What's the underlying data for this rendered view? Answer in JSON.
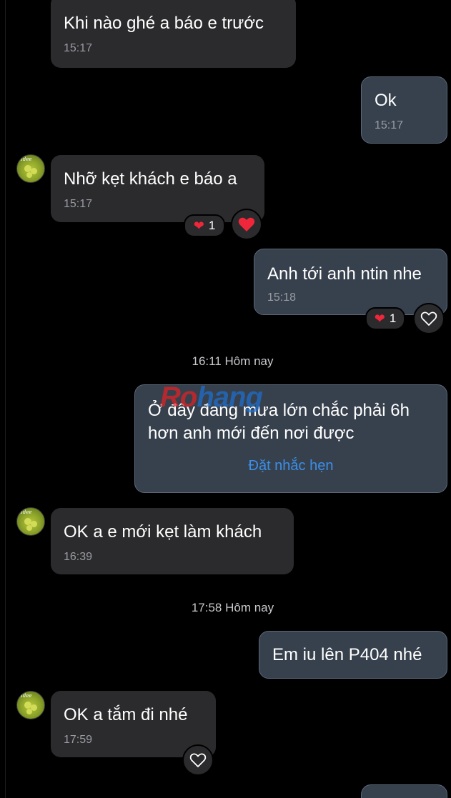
{
  "colors": {
    "background": "#000000",
    "incoming_bubble": "#2b2b2d",
    "outgoing_bubble": "#37414d",
    "outgoing_border": "#5b6878",
    "heart": "#f0263a",
    "link": "#3b8fe8"
  },
  "messages": [
    {
      "direction": "incoming",
      "text": "Khi nào ghé a báo e trước",
      "time": "15:17"
    },
    {
      "direction": "outgoing",
      "text": "Ok",
      "time": "15:17"
    },
    {
      "direction": "incoming",
      "text": "Nhỡ kẹt khách e báo a",
      "time": "15:17",
      "reaction": {
        "emoji": "heart",
        "count": "1"
      },
      "react_button": "heart-filled-icon"
    },
    {
      "direction": "outgoing",
      "text": "Anh tới anh ntin nhe",
      "time": "15:18",
      "reaction": {
        "emoji": "heart",
        "count": "1"
      },
      "react_button": "heart-outline-icon"
    },
    {
      "direction": "outgoing",
      "text": "Ở đây đang mưa lớn chắc phải 6h\nhơn anh mới đến nơi được",
      "action_link": "Đặt nhắc hẹn"
    },
    {
      "direction": "incoming",
      "text": "OK a e mới kẹt làm khách",
      "time": "16:39"
    },
    {
      "direction": "outgoing",
      "text": "Em iu lên P404 nhé"
    },
    {
      "direction": "incoming",
      "text": "OK a tắm đi nhé",
      "time": "17:59",
      "react_button": "heart-outline-icon"
    }
  ],
  "separators": [
    {
      "text": "16:11 Hôm nay"
    },
    {
      "text": "17:58 Hôm nay"
    }
  ],
  "watermark": {
    "part1": "Ro",
    "part2": "hang"
  }
}
